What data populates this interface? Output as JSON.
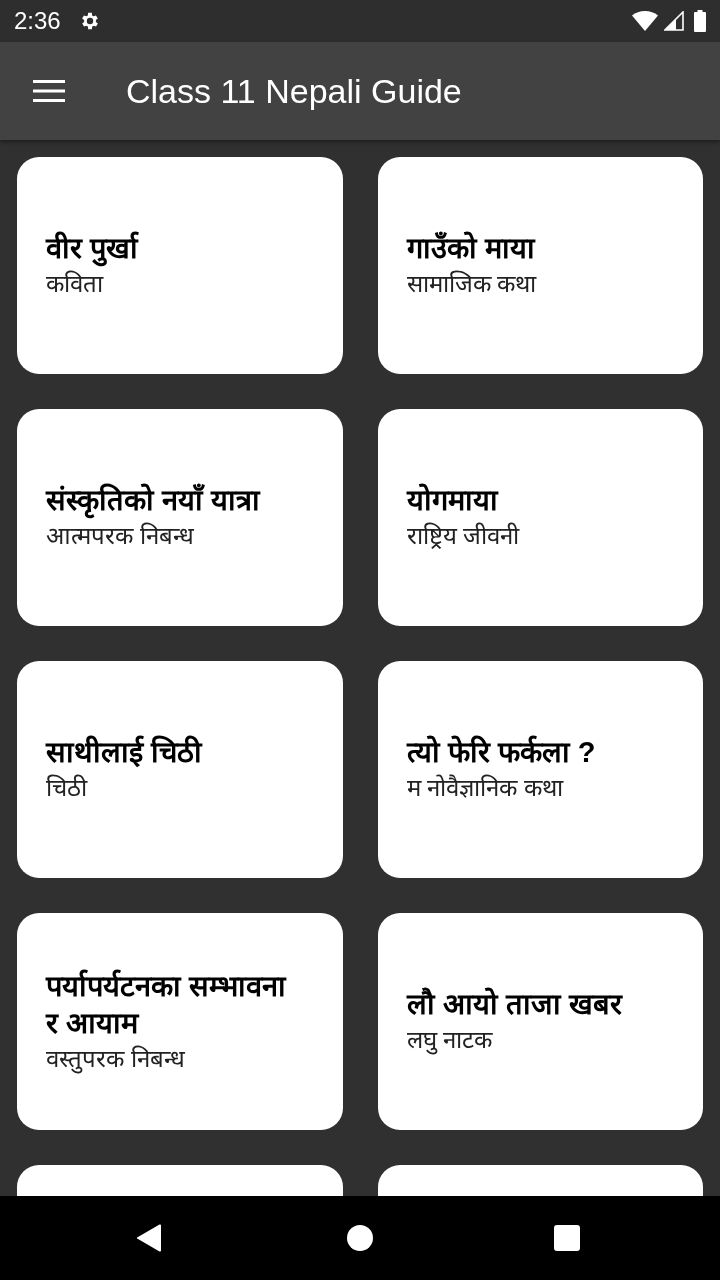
{
  "status_bar": {
    "time": "2:36"
  },
  "app_bar": {
    "title": "Class 11 Nepali Guide"
  },
  "cards": [
    {
      "kind": "lesson",
      "title": "वीर पुर्खा",
      "subtitle": "कविता"
    },
    {
      "kind": "lesson",
      "title": "गाउँको माया",
      "subtitle": "सामाजिक कथा"
    },
    {
      "kind": "lesson",
      "title": "संस्कृतिको नयाँ यात्रा",
      "subtitle": "आत्मपरक निबन्ध"
    },
    {
      "kind": "lesson",
      "title": "योगमाया",
      "subtitle": "राष्ट्रिय जीवनी"
    },
    {
      "kind": "lesson",
      "title": "साथीलाई चिठी",
      "subtitle": "चिठी"
    },
    {
      "kind": "lesson",
      "title": "त्यो फेरि फर्कला ?",
      "subtitle": "म नोवैज्ञानिक कथा"
    },
    {
      "kind": "lesson",
      "title": "पर्यापर्यटनका सम्भावना र आयाम",
      "subtitle": "वस्तुपरक निबन्ध"
    },
    {
      "kind": "lesson",
      "title": "लौ आयो ताजा खबर",
      "subtitle": "लघु नाटक"
    },
    {
      "kind": "cut-off"
    },
    {
      "kind": "cut-off"
    }
  ]
}
